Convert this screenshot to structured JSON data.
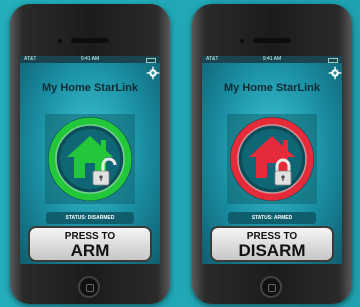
{
  "phones": [
    {
      "id": "left",
      "status_bar": {
        "carrier": "AT&T",
        "time": "9:41 AM"
      },
      "app_title": "My Home StarLink",
      "state_color": "#22c83a",
      "status_text": "STATUS: DISARMED",
      "button": {
        "line1": "PRESS TO",
        "line2": "ARM"
      }
    },
    {
      "id": "right",
      "status_bar": {
        "carrier": "AT&T",
        "time": "9:41 AM"
      },
      "app_title": "My Home StarLink",
      "state_color": "#e52a3a",
      "status_text": "STATUS: ARMED",
      "button": {
        "line1": "PRESS TO",
        "line2": "DISARM"
      }
    }
  ],
  "icons": {
    "settings": "gear-icon",
    "home": "house-icon",
    "lock": "padlock-icon"
  }
}
